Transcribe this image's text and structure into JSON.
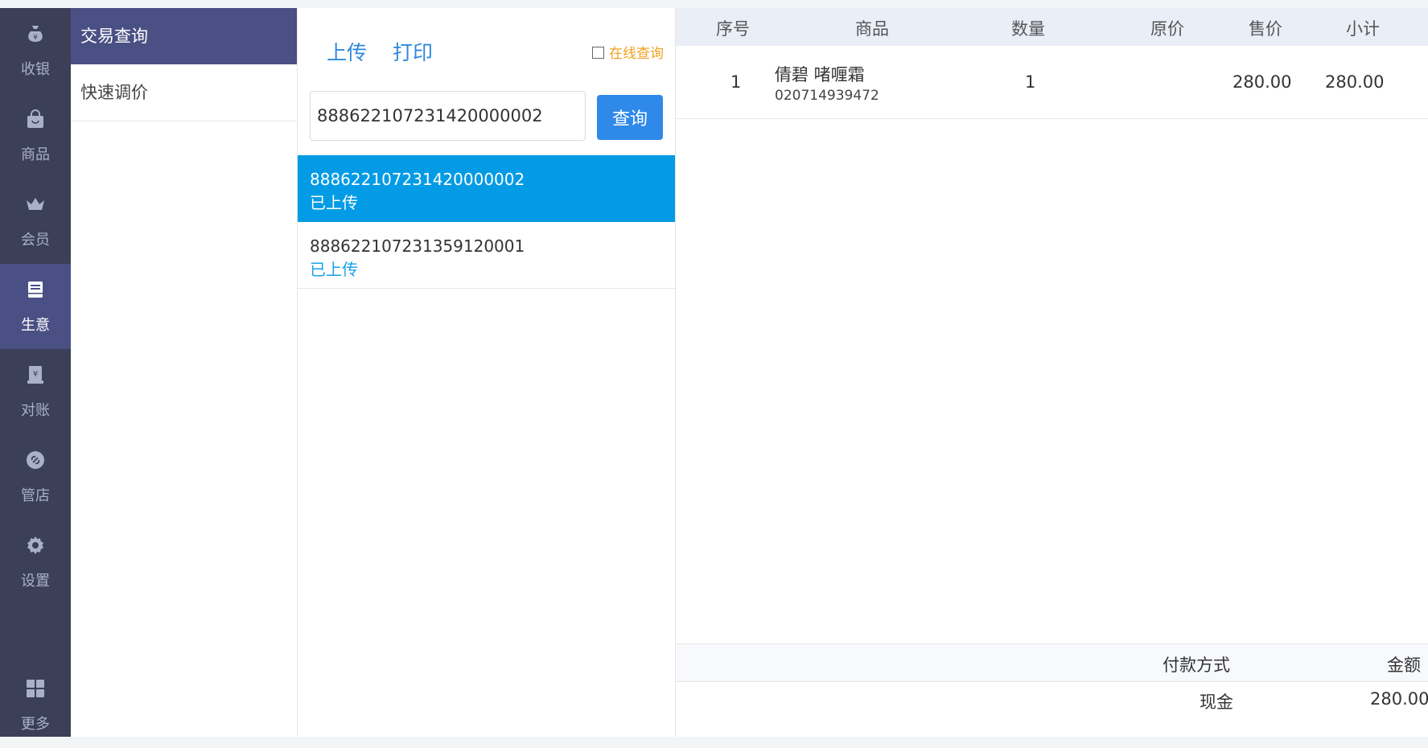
{
  "nav": [
    {
      "label": "收银",
      "icon": "money-bag-icon"
    },
    {
      "label": "商品",
      "icon": "shopping-bag-icon"
    },
    {
      "label": "会员",
      "icon": "crown-icon"
    },
    {
      "label": "生意",
      "icon": "register-icon",
      "active": true
    },
    {
      "label": "对账",
      "icon": "ledger-icon"
    },
    {
      "label": "管店",
      "icon": "store-link-icon"
    },
    {
      "label": "设置",
      "icon": "gear-icon"
    },
    {
      "label": "更多",
      "icon": "grid-icon"
    }
  ],
  "submenu": [
    {
      "label": "交易查询",
      "active": true
    },
    {
      "label": "快速调价",
      "active": false
    }
  ],
  "toolbar": {
    "upload_label": "上传",
    "print_label": "打印",
    "online_query_label": "在线查询"
  },
  "search": {
    "value": "888622107231420000002",
    "button_label": "查询"
  },
  "transactions": [
    {
      "number": "888622107231420000002",
      "status": "已上传",
      "selected": true
    },
    {
      "number": "888622107231359120001",
      "status": "已上传",
      "selected": false
    }
  ],
  "detail": {
    "columns": {
      "index": "序号",
      "product": "商品",
      "quantity": "数量",
      "original_price": "原价",
      "sale_price": "售价",
      "subtotal": "小计"
    },
    "items": [
      {
        "index": "1",
        "name": "倩碧  啫喱霜",
        "code": "020714939472",
        "quantity": "1",
        "original_price": "",
        "sale_price": "280.00",
        "subtotal": "280.00"
      }
    ],
    "payment_columns": {
      "method": "付款方式",
      "amount": "金额"
    },
    "payments": [
      {
        "method": "现金",
        "amount": "280.00"
      }
    ]
  },
  "colors": {
    "rail": "#3b3f57",
    "active": "#4a5084",
    "selected_row": "#039be5",
    "link": "#2f89de",
    "button": "#2f89e9",
    "online_query": "#f0a020"
  }
}
